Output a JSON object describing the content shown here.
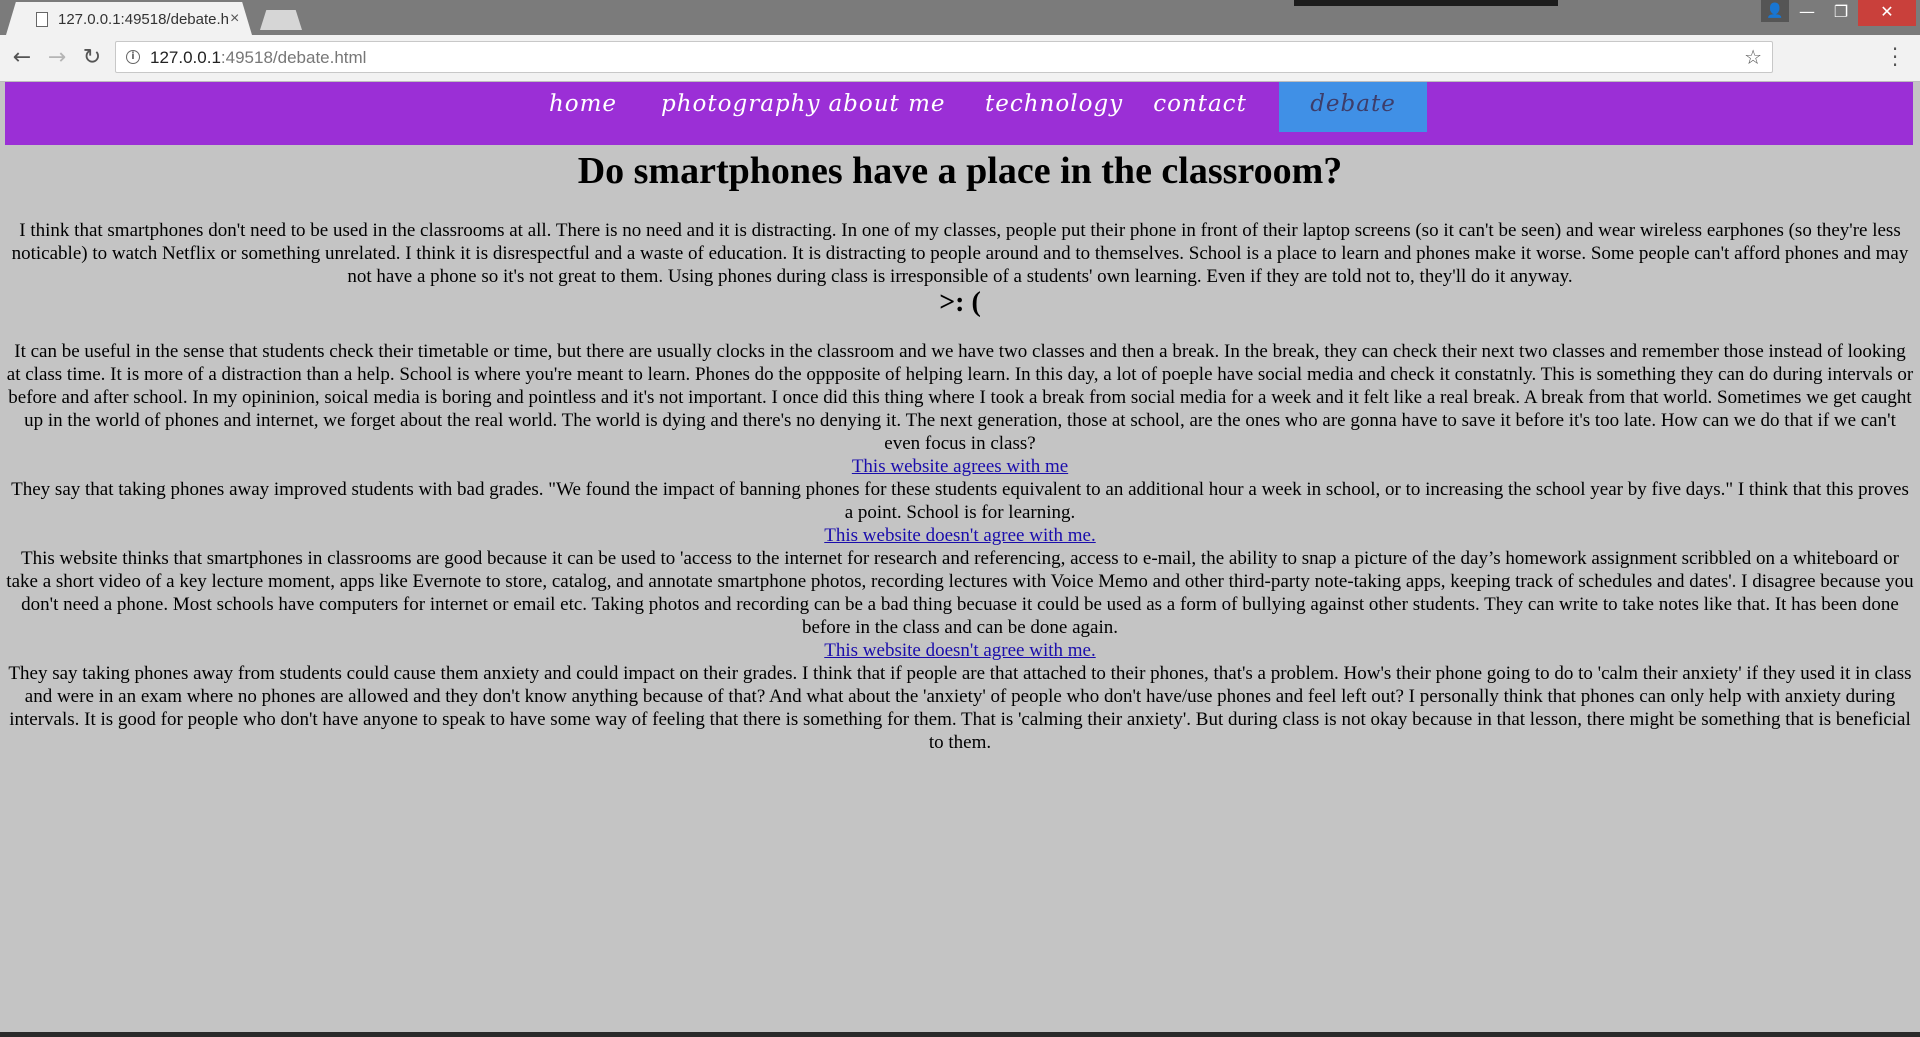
{
  "browser": {
    "tab_title": "127.0.0.1:49518/debate.h",
    "tab_close": "×",
    "url_host": "127.0.0.1",
    "url_rest": ":49518/debate.html",
    "icons": {
      "back": "arrow-left",
      "forward": "arrow-right",
      "reload": "reload",
      "info": "info-circle",
      "star": "star",
      "menu": "vertical-dots"
    }
  },
  "window_controls": {
    "minimize": "—",
    "maximize": "❐",
    "close": "✕",
    "user": "👤"
  },
  "nav": {
    "accent_color": "#9b2fd6",
    "active_color": "#4090e6",
    "items": [
      {
        "label": "home"
      },
      {
        "label": "photography"
      },
      {
        "label": "about me"
      },
      {
        "label": "technology"
      },
      {
        "label": "contact"
      },
      {
        "label": "debate",
        "active": true
      }
    ]
  },
  "main": {
    "title": "Do smartphones have a place in the classroom?",
    "paragraph1": "I think that smartphones don't need to be used in the classrooms at all. There is no need and it is distracting. In one of my classes, people put their phone in front of their laptop screens (so it can't be seen) and wear wireless earphones (so they're less noticable) to watch Netflix or something unrelated. I think it is disrespectful and a waste of education. It is distracting to people around and to themselves. School is a place to learn and phones make it worse. Some people can't afford phones and may not have a phone so it's not great to them. Using phones during class is irresponsible of a students' own learning. Even if they are told not to, they'll do it anyway.",
    "face": ">: (",
    "paragraph2": "It can be useful in the sense that students check their timetable or time, but there are usually clocks in the classroom and we have two classes and then a break. In the break, they can check their next two classes and remember those instead of looking at class time. It is more of a distraction than a help. School is where you're meant to learn. Phones do the oppposite of helping learn. In this day, a lot of poeple have social media and check it constatnly. This is something they can do during intervals or before and after school. In my opininion, soical media is boring and pointless and it's not important. I once did this thing where I took a break from social media for a week and it felt like a real break. A break from that world. Sometimes we get caught up in the world of phones and internet, we forget about the real world. The world is dying and there's no denying it. The next generation, those at school, are the ones who are gonna have to save it before it's too late. How can we do that if we can't even focus in class?",
    "link1": "This website agrees with me",
    "paragraph3": "They say that taking phones away improved students with bad grades. \"We found the impact of banning phones for these students equivalent to an additional hour a week in school, or to increasing the school year by five days.\" I think that this proves a point. School is for learning.",
    "link2": "This website doesn't agree with me.",
    "paragraph4": "This website thinks that smartphones in classrooms are good because it can be used to 'access to the internet for research and referencing, access to e-mail, the ability to snap a picture of the day’s homework assignment scribbled on a whiteboard or take a short video of a key lecture moment, apps like Evernote to store, catalog, and annotate smartphone photos, recording lectures with Voice Memo and other third-party note-taking apps, keeping track of schedules and dates'. I disagree because you don't need a phone. Most schools have computers for internet or email etc. Taking photos and recording can be a bad thing becuase it could be used as a form of bullying against other students. They can write to take notes like that. It has been done before in the class and can be done again.",
    "link3": "This website doesn't agree with me.",
    "paragraph5": "They say taking phones away from students could cause them anxiety and could impact on their grades. I think that if people are that attached to their phones, that's a problem. How's their phone going to do to 'calm their anxiety' if they used it in class and were in an exam where no phones are allowed and they don't know anything because of that? And what about the 'anxiety' of people who don't have/use phones and feel left out? I personally think that phones can only help with anxiety during intervals. It is good for people who don't have anyone to speak to have some way of feeling that there is something for them. That is 'calming their anxiety'. But during class is not okay because in that lesson, there might be something that is beneficial to them."
  }
}
